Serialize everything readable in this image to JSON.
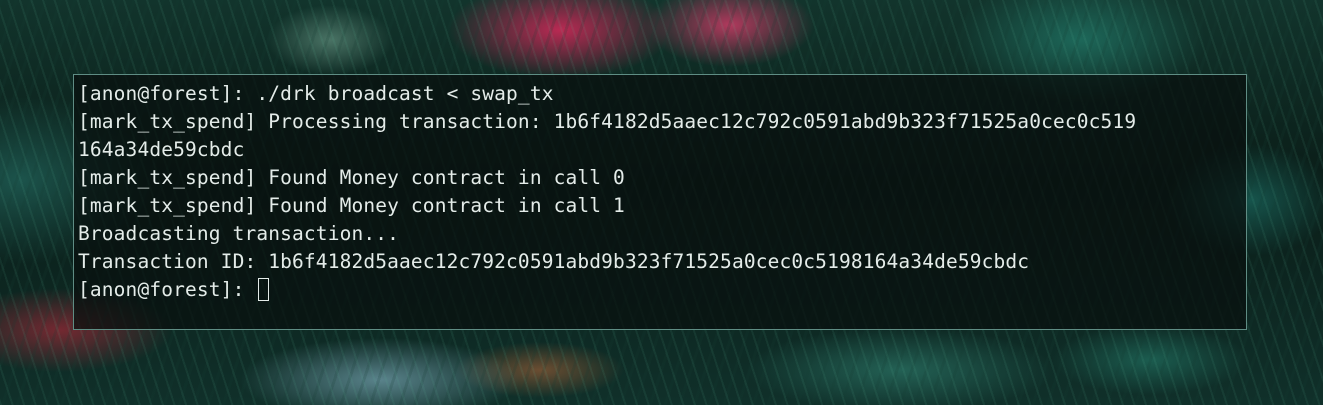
{
  "terminal": {
    "lines": [
      "[anon@forest]: ./drk broadcast < swap_tx",
      "[mark_tx_spend] Processing transaction: 1b6f4182d5aaec12c792c0591abd9b323f71525a0cec0c519",
      "164a34de59cbdc",
      "[mark_tx_spend] Found Money contract in call 0",
      "[mark_tx_spend] Found Money contract in call 1",
      "Broadcasting transaction...",
      "Transaction ID: 1b6f4182d5aaec12c792c0591abd9b323f71525a0cec0c5198164a34de59cbdc"
    ],
    "prompt": "[anon@forest]: ",
    "colors": {
      "text": "#e4ece9",
      "border": "#5f8d84",
      "background": "#080f0e"
    }
  }
}
